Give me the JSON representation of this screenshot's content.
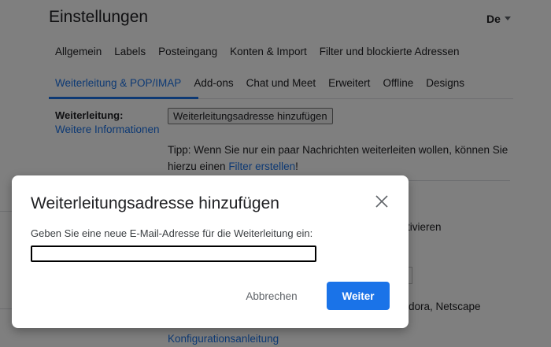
{
  "page": {
    "title": "Einstellungen",
    "language": "De"
  },
  "tabs": {
    "row1": [
      "Allgemein",
      "Labels",
      "Posteingang",
      "Konten & Import",
      "Filter und blockierte Adressen"
    ],
    "row2": [
      "Weiterleitung & POP/IMAP",
      "Add-ons",
      "Chat und Meet",
      "Erweitert",
      "Offline",
      "Designs"
    ],
    "active": "Weiterleitung & POP/IMAP"
  },
  "forwarding": {
    "label": "Weiterleitung:",
    "more_info": "Weitere Informationen",
    "add_button": "Weiterleitungsadresse hinzufügen",
    "tip_before": "Tipp: Wenn Sie nur ein paar Nachrichten weiterleiten wollen, können Sie hierzu einen ",
    "tip_link": "Filter erstellen",
    "tip_after": "!"
  },
  "background": {
    "partial_activate": "tivieren",
    "partial_clients": "dora, Netscape",
    "config_link": "Konfigurationsanleitung"
  },
  "dialog": {
    "title": "Weiterleitungsadresse hinzufügen",
    "prompt": "Geben Sie eine neue E-Mail-Adresse für die Weiterleitung ein:",
    "input_value": "",
    "cancel_label": "Abbrechen",
    "next_label": "Weiter"
  },
  "colors": {
    "accent": "#1a73e8",
    "text": "#202124",
    "overlay": "rgba(0,0,0,0.5)"
  }
}
